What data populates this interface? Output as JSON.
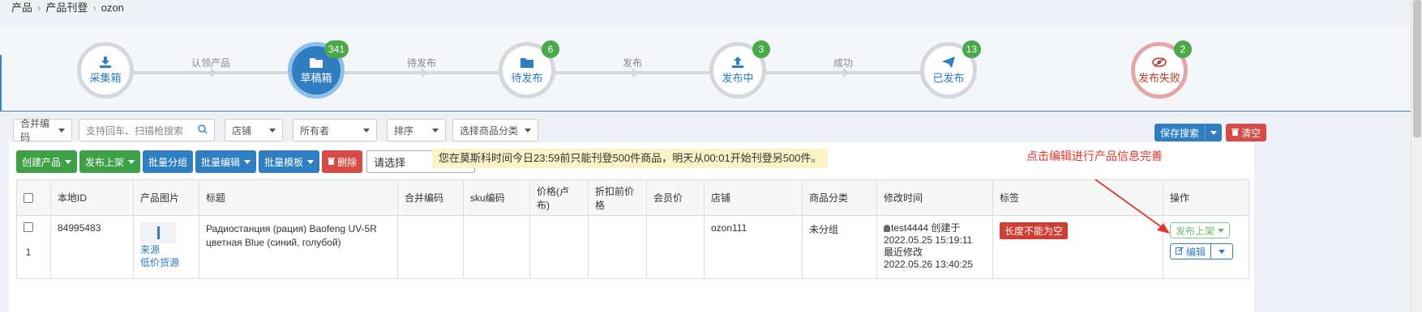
{
  "breadcrumb": [
    "产品",
    "产品刊登",
    "ozon"
  ],
  "flow": {
    "steps": [
      {
        "label": "采集箱",
        "badge": "",
        "icon": "download-icon"
      },
      {
        "label": "草稿箱",
        "badge": "341",
        "icon": "folder-icon"
      },
      {
        "label": "待发布",
        "badge": "6",
        "icon": "folder-icon"
      },
      {
        "label": "发布中",
        "badge": "3",
        "icon": "upload-icon"
      },
      {
        "label": "已发布",
        "badge": "13",
        "icon": "send-icon"
      },
      {
        "label": "发布失败",
        "badge": "2",
        "icon": "eye-slash-icon"
      }
    ],
    "transitions": [
      "认领产品",
      "待发布",
      "发布",
      "成功"
    ]
  },
  "filters": {
    "merge_code": "合并编码",
    "search_placeholder": "支持回车、扫描枪搜索",
    "store": "店铺",
    "owner": "所有者",
    "sort": "排序",
    "category": "选择商品分类",
    "save_search": "保存搜索",
    "clear": "清空"
  },
  "toolbar": {
    "create": "创建产品",
    "publish": "发布上架",
    "batch_group": "批量分组",
    "batch_edit": "批量编辑",
    "batch_template": "批量模板",
    "delete": "删除",
    "choose": "请选择"
  },
  "notice": "您在莫斯科时间今日23:59前只能刊登500件商品，明天从00:01开始刊登另500件。",
  "hint": "点击编辑进行产品信息完善",
  "table": {
    "headers": [
      "本地ID",
      "产品图片",
      "标题",
      "合并编码",
      "sku编码",
      "价格(卢布)",
      "折扣前价格",
      "会员价",
      "店铺",
      "商品分类",
      "修改时间",
      "标签",
      "操作"
    ],
    "rows": [
      {
        "index": "1",
        "id": "84995483",
        "img_link1": "来源",
        "img_link2": "低价货源",
        "title": "Радиостанция (рация) Baofeng UV-5R цветная Blue (синий, голубой)",
        "merge_code": "",
        "sku": "",
        "price": "",
        "orig_price": "",
        "member_price": "",
        "store": "ozon111",
        "category": "未分组",
        "creator": "test4444 创建于",
        "created": "2022.05.25 15:19:11",
        "modified_label": "最近修改",
        "modified": "2022.05.26 13:40:25",
        "tag": "长度不能为空",
        "op_publish": "发布上架",
        "op_edit": "编辑"
      }
    ]
  },
  "colors": {
    "primary": "#2f7ec2",
    "success": "#3ea148",
    "danger": "#d64b47",
    "hint": "#e2362f"
  }
}
